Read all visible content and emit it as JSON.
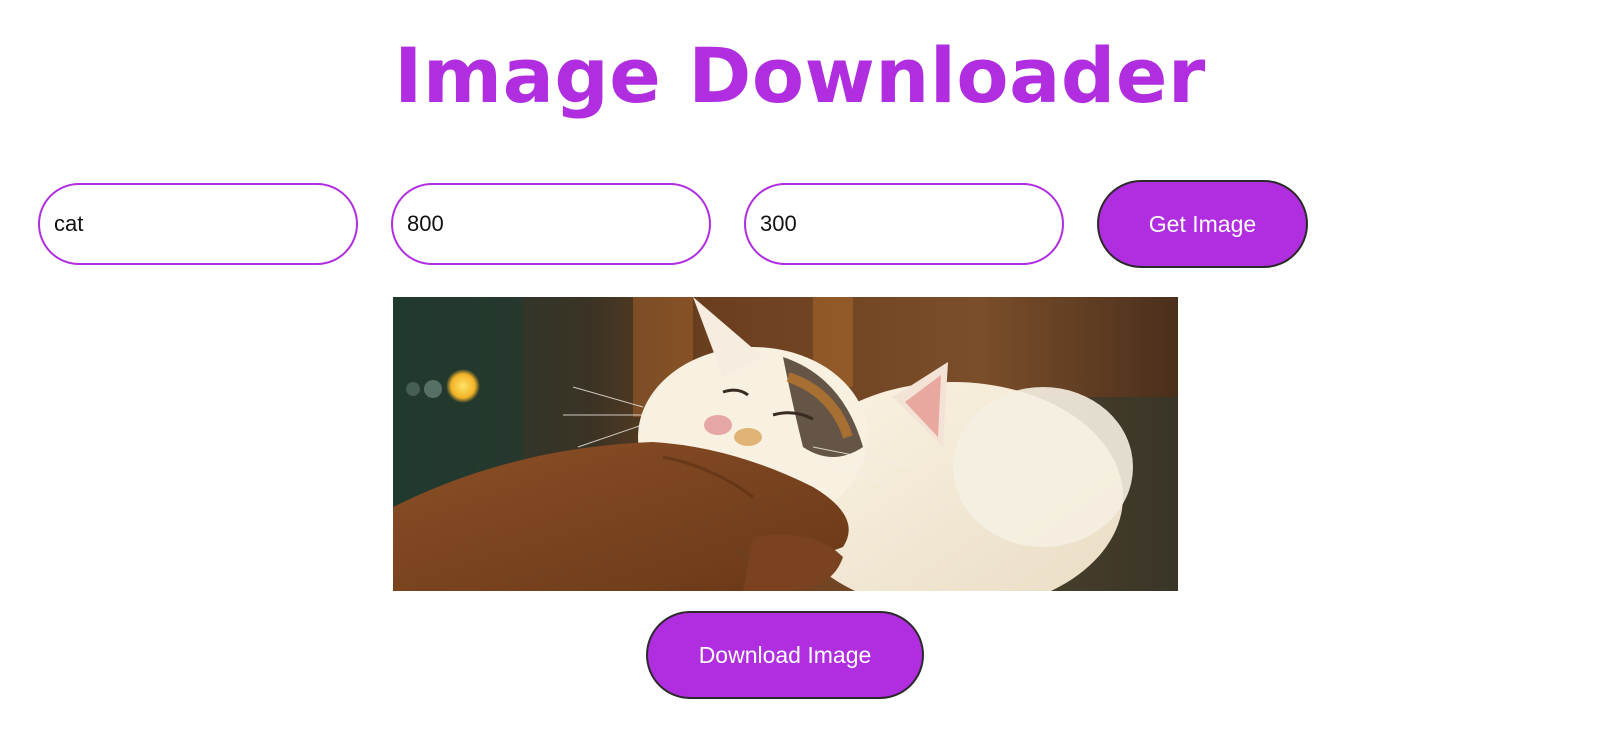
{
  "header": {
    "title": "Image Downloader"
  },
  "form": {
    "search_value": "cat",
    "width_value": "800",
    "height_value": "300",
    "get_button_label": "Get Image"
  },
  "result": {
    "download_button_label": "Download Image"
  },
  "colors": {
    "accent": "#b02de0",
    "button_text": "#ffffff",
    "page_background": "#ffffff"
  }
}
